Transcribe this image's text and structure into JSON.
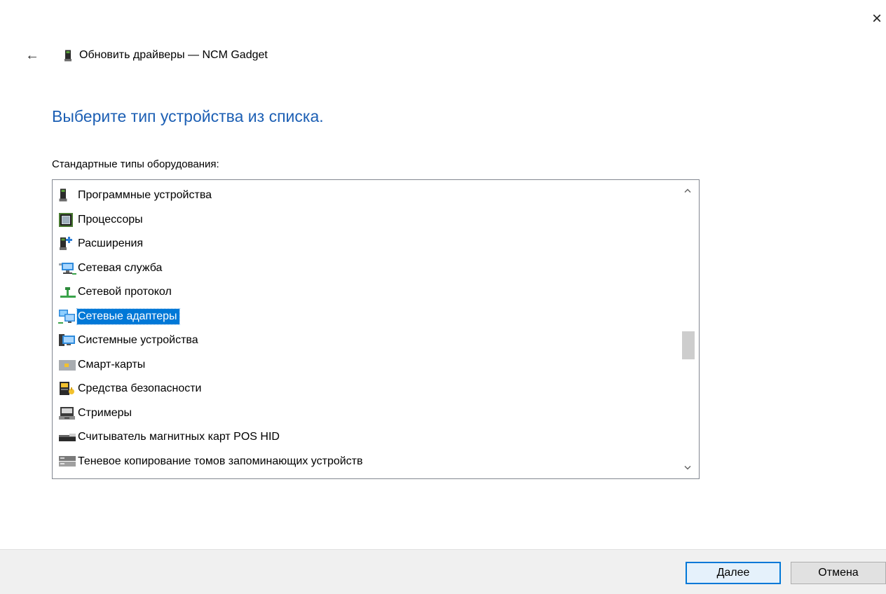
{
  "window": {
    "close_symbol": "×",
    "back_symbol": "←",
    "title": "Обновить драйверы — NCM Gadget",
    "title_icon": "device-icon"
  },
  "main": {
    "instruction": "Выберите тип устройства из списка.",
    "list_label": "Стандартные типы оборудования:"
  },
  "device_list": {
    "items": [
      {
        "label": "Программные устройства",
        "icon": "software-device-icon",
        "selected": false
      },
      {
        "label": "Процессоры",
        "icon": "processor-icon",
        "selected": false
      },
      {
        "label": "Расширения",
        "icon": "extension-icon",
        "selected": false
      },
      {
        "label": "Сетевая служба",
        "icon": "network-service-icon",
        "selected": false
      },
      {
        "label": "Сетевой протокол",
        "icon": "network-protocol-icon",
        "selected": false
      },
      {
        "label": "Сетевые адаптеры",
        "icon": "network-adapter-icon",
        "selected": true
      },
      {
        "label": "Системные устройства",
        "icon": "system-device-icon",
        "selected": false
      },
      {
        "label": "Смарт-карты",
        "icon": "smart-card-icon",
        "selected": false
      },
      {
        "label": "Средства безопасности",
        "icon": "security-device-icon",
        "selected": false
      },
      {
        "label": "Стримеры",
        "icon": "tape-drive-icon",
        "selected": false
      },
      {
        "label": "Считыватель магнитных карт POS HID",
        "icon": "card-reader-icon",
        "selected": false
      },
      {
        "label": "Теневое копирование томов запоминающих устройств",
        "icon": "volume-shadow-copy-icon",
        "selected": false
      },
      {
        "label": "",
        "icon": "partial-item-icon",
        "selected": false
      }
    ],
    "scroll_position": 0.57
  },
  "footer": {
    "next_label": "Далее",
    "cancel_label": "Отмена"
  }
}
